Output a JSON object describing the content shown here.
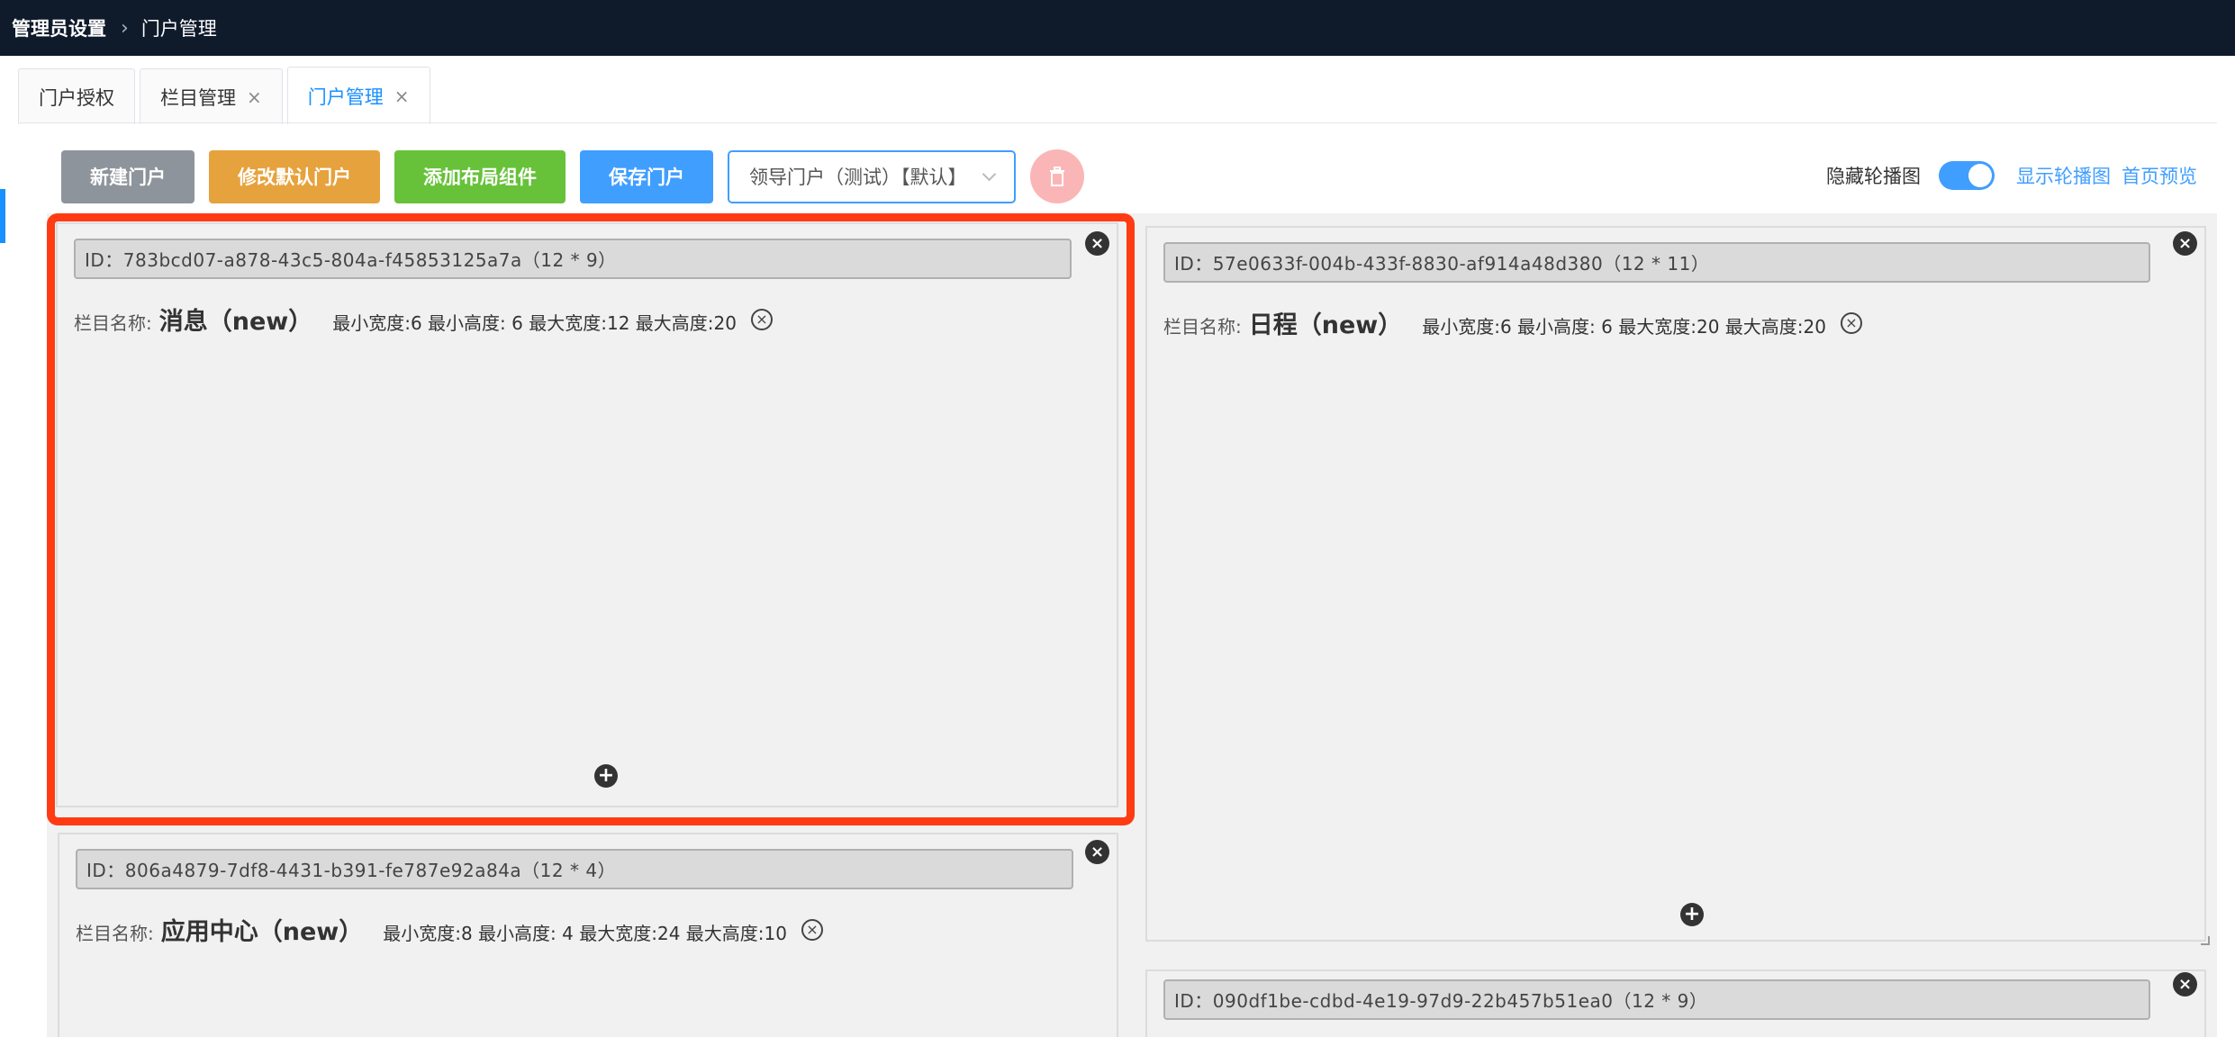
{
  "breadcrumb": {
    "root": "管理员设置",
    "current": "门户管理"
  },
  "tabs": [
    {
      "label": "门户授权",
      "closable": false,
      "active": false
    },
    {
      "label": "栏目管理",
      "closable": true,
      "active": false
    },
    {
      "label": "门户管理",
      "closable": true,
      "active": true
    }
  ],
  "toolbar": {
    "new_portal": "新建门户",
    "set_default": "修改默认门户",
    "add_layout": "添加布局组件",
    "save_portal": "保存门户",
    "portal_select_value": "领导门户（测试）【默认】"
  },
  "carousel": {
    "hide_label": "隐藏轮播图",
    "switch_on": true,
    "show_label": "显示轮播图",
    "preview_label": "首页预览"
  },
  "widgets": [
    {
      "id_text": "ID：783bcd07-a878-43c5-804a-f45853125a7a（12 * 9）",
      "name_label": "栏目名称:",
      "name": "消息（new）",
      "dims": "最小宽度:6 最小高度: 6 最大宽度:12 最大高度:20",
      "highlighted": true
    },
    {
      "id_text": "ID：57e0633f-004b-433f-8830-af914a48d380（12 * 11）",
      "name_label": "栏目名称:",
      "name": "日程（new）",
      "dims": "最小宽度:6 最小高度: 6 最大宽度:20 最大高度:20",
      "highlighted": false
    },
    {
      "id_text": "ID：806a4879-7df8-4431-b391-fe787e92a84a（12 * 4）",
      "name_label": "栏目名称:",
      "name": "应用中心（new）",
      "dims": "最小宽度:8 最小高度: 4 最大宽度:24 最大高度:10",
      "highlighted": false
    },
    {
      "id_text": "ID：090df1be-cdbd-4e19-97d9-22b457b51ea0（12 * 9）",
      "name_label": "",
      "name": "",
      "dims": "",
      "highlighted": false
    }
  ],
  "icons": {
    "close": "close-circle-icon",
    "add": "plus-circle-icon",
    "delete": "trash-icon",
    "remove": "x-circle-icon"
  },
  "colors": {
    "accent": "#409eff",
    "highlight": "#ff3b14",
    "topbar": "#0f1a2b"
  }
}
